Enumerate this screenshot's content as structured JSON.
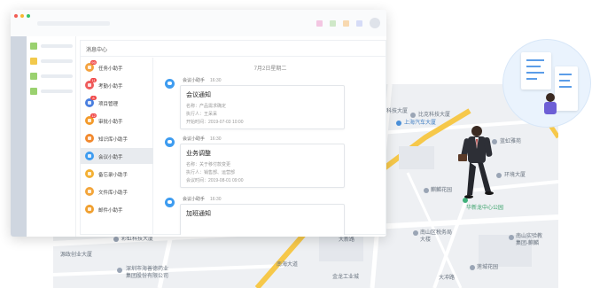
{
  "window": {
    "panel_title": "消息中心"
  },
  "assistants": [
    {
      "label": "任务小助手",
      "color": "#f4a340",
      "badge": "99"
    },
    {
      "label": "考勤小助手",
      "color": "#ef5b5b",
      "badge": "11"
    },
    {
      "label": "项目管理",
      "color": "#4a7fe0",
      "badge": "8"
    },
    {
      "label": "审批小助手",
      "color": "#f39a2b",
      "badge": "12"
    },
    {
      "label": "知识库小助手",
      "color": "#f2892e",
      "badge": ""
    },
    {
      "label": "会议小助手",
      "color": "#3e9cf0",
      "badge": ""
    },
    {
      "label": "备忘录小助手",
      "color": "#f3b034",
      "badge": ""
    },
    {
      "label": "文件库小助手",
      "color": "#f3a53a",
      "badge": ""
    },
    {
      "label": "邮件小助手",
      "color": "#f0a030",
      "badge": ""
    }
  ],
  "chat": {
    "date": "7月2日星期二",
    "messages": [
      {
        "sender": "会议小助手",
        "time": "16:30",
        "title": "会议通知",
        "lines": [
          "名称：产品需求确定",
          "执行人：王呆呆",
          "开始时间：2019-07-03 10:00"
        ]
      },
      {
        "sender": "会议小助手",
        "time": "16:30",
        "title": "业务调整",
        "lines": [
          "名称：关于移付款变更",
          "执行人：销售部、运营部",
          "会议时间：2019-08-01 09:00"
        ]
      },
      {
        "sender": "会议小助手",
        "time": "16:30",
        "title": "加班通知",
        "lines": []
      }
    ]
  },
  "map_labels": [
    {
      "text": "比克科技大厦",
      "style": "plain"
    },
    {
      "text": "上海汽车大厦",
      "style": "blue"
    },
    {
      "text": "蓝虹雅苑",
      "style": "plain"
    },
    {
      "text": "环境大厦",
      "style": "plain"
    },
    {
      "text": "麒麟花园",
      "style": "plain"
    },
    {
      "text": "华新龙中心公园",
      "style": "green"
    },
    {
      "text": "南山区税务局\n大楼",
      "style": "plain"
    },
    {
      "text": "南山实验教\n集团-麒麟",
      "style": "plain"
    },
    {
      "text": "莲城花园",
      "style": "plain"
    },
    {
      "text": "彩虹科技大厦",
      "style": "plain"
    },
    {
      "text": "源政创业大厦",
      "style": "plain"
    },
    {
      "text": "深圳市海善德药业\n集团股份有限公司",
      "style": "plain"
    },
    {
      "text": "金龙工业城",
      "style": "plain"
    },
    {
      "text": "科技大厦",
      "style": "plain"
    },
    {
      "text": "大新路",
      "style": "plain"
    },
    {
      "text": "南海大道",
      "style": "plain"
    },
    {
      "text": "大冲路",
      "style": "plain"
    }
  ]
}
